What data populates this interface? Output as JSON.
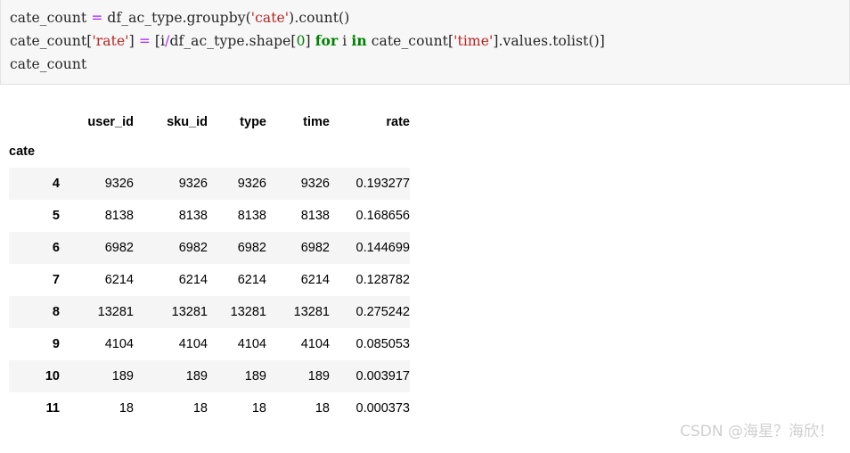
{
  "code_cell": {
    "background": "#f7f7f7",
    "border_color": "#e3e3e3",
    "colors": {
      "string": "#bb2222",
      "number": "#008000",
      "keyword": "#008000",
      "operator": "#aa22ff",
      "plain": "#262626"
    },
    "lines": [
      {
        "id": "line-1",
        "tokens": [
          {
            "t": "cate_count ",
            "c": "plain"
          },
          {
            "t": "=",
            "c": "op"
          },
          {
            "t": " df_ac_type.groupby(",
            "c": "plain"
          },
          {
            "t": "'cate'",
            "c": "str"
          },
          {
            "t": ").count()",
            "c": "plain"
          }
        ]
      },
      {
        "id": "line-2",
        "tokens": [
          {
            "t": "cate_count[",
            "c": "plain"
          },
          {
            "t": "'rate'",
            "c": "str"
          },
          {
            "t": "] ",
            "c": "plain"
          },
          {
            "t": "=",
            "c": "op"
          },
          {
            "t": " [i",
            "c": "plain"
          },
          {
            "t": "/",
            "c": "op"
          },
          {
            "t": "df_ac_type.shape[",
            "c": "plain"
          },
          {
            "t": "0",
            "c": "num"
          },
          {
            "t": "] ",
            "c": "plain"
          },
          {
            "t": "for",
            "c": "kw"
          },
          {
            "t": " i ",
            "c": "plain"
          },
          {
            "t": "in",
            "c": "kw"
          },
          {
            "t": " cate_count[",
            "c": "plain"
          },
          {
            "t": "'time'",
            "c": "str"
          },
          {
            "t": "].values.tolist()]",
            "c": "plain"
          }
        ]
      },
      {
        "id": "line-3",
        "tokens": [
          {
            "t": "cate_count",
            "c": "plain"
          }
        ]
      }
    ]
  },
  "dataframe": {
    "index_name": "cate",
    "columns": [
      "user_id",
      "sku_id",
      "type",
      "time",
      "rate"
    ],
    "rows": [
      {
        "index": "4",
        "cells": [
          "9326",
          "9326",
          "9326",
          "9326",
          "0.193277"
        ]
      },
      {
        "index": "5",
        "cells": [
          "8138",
          "8138",
          "8138",
          "8138",
          "0.168656"
        ]
      },
      {
        "index": "6",
        "cells": [
          "6982",
          "6982",
          "6982",
          "6982",
          "0.144699"
        ]
      },
      {
        "index": "7",
        "cells": [
          "6214",
          "6214",
          "6214",
          "6214",
          "0.128782"
        ]
      },
      {
        "index": "8",
        "cells": [
          "13281",
          "13281",
          "13281",
          "13281",
          "0.275242"
        ]
      },
      {
        "index": "9",
        "cells": [
          "4104",
          "4104",
          "4104",
          "4104",
          "0.085053"
        ]
      },
      {
        "index": "10",
        "cells": [
          "189",
          "189",
          "189",
          "189",
          "0.003917"
        ]
      },
      {
        "index": "11",
        "cells": [
          "18",
          "18",
          "18",
          "18",
          "0.000373"
        ]
      }
    ],
    "stripe_color": "#f5f5f5"
  },
  "watermark": {
    "text": "CSDN @海星？海欣！",
    "color": "#cfcfcf"
  }
}
